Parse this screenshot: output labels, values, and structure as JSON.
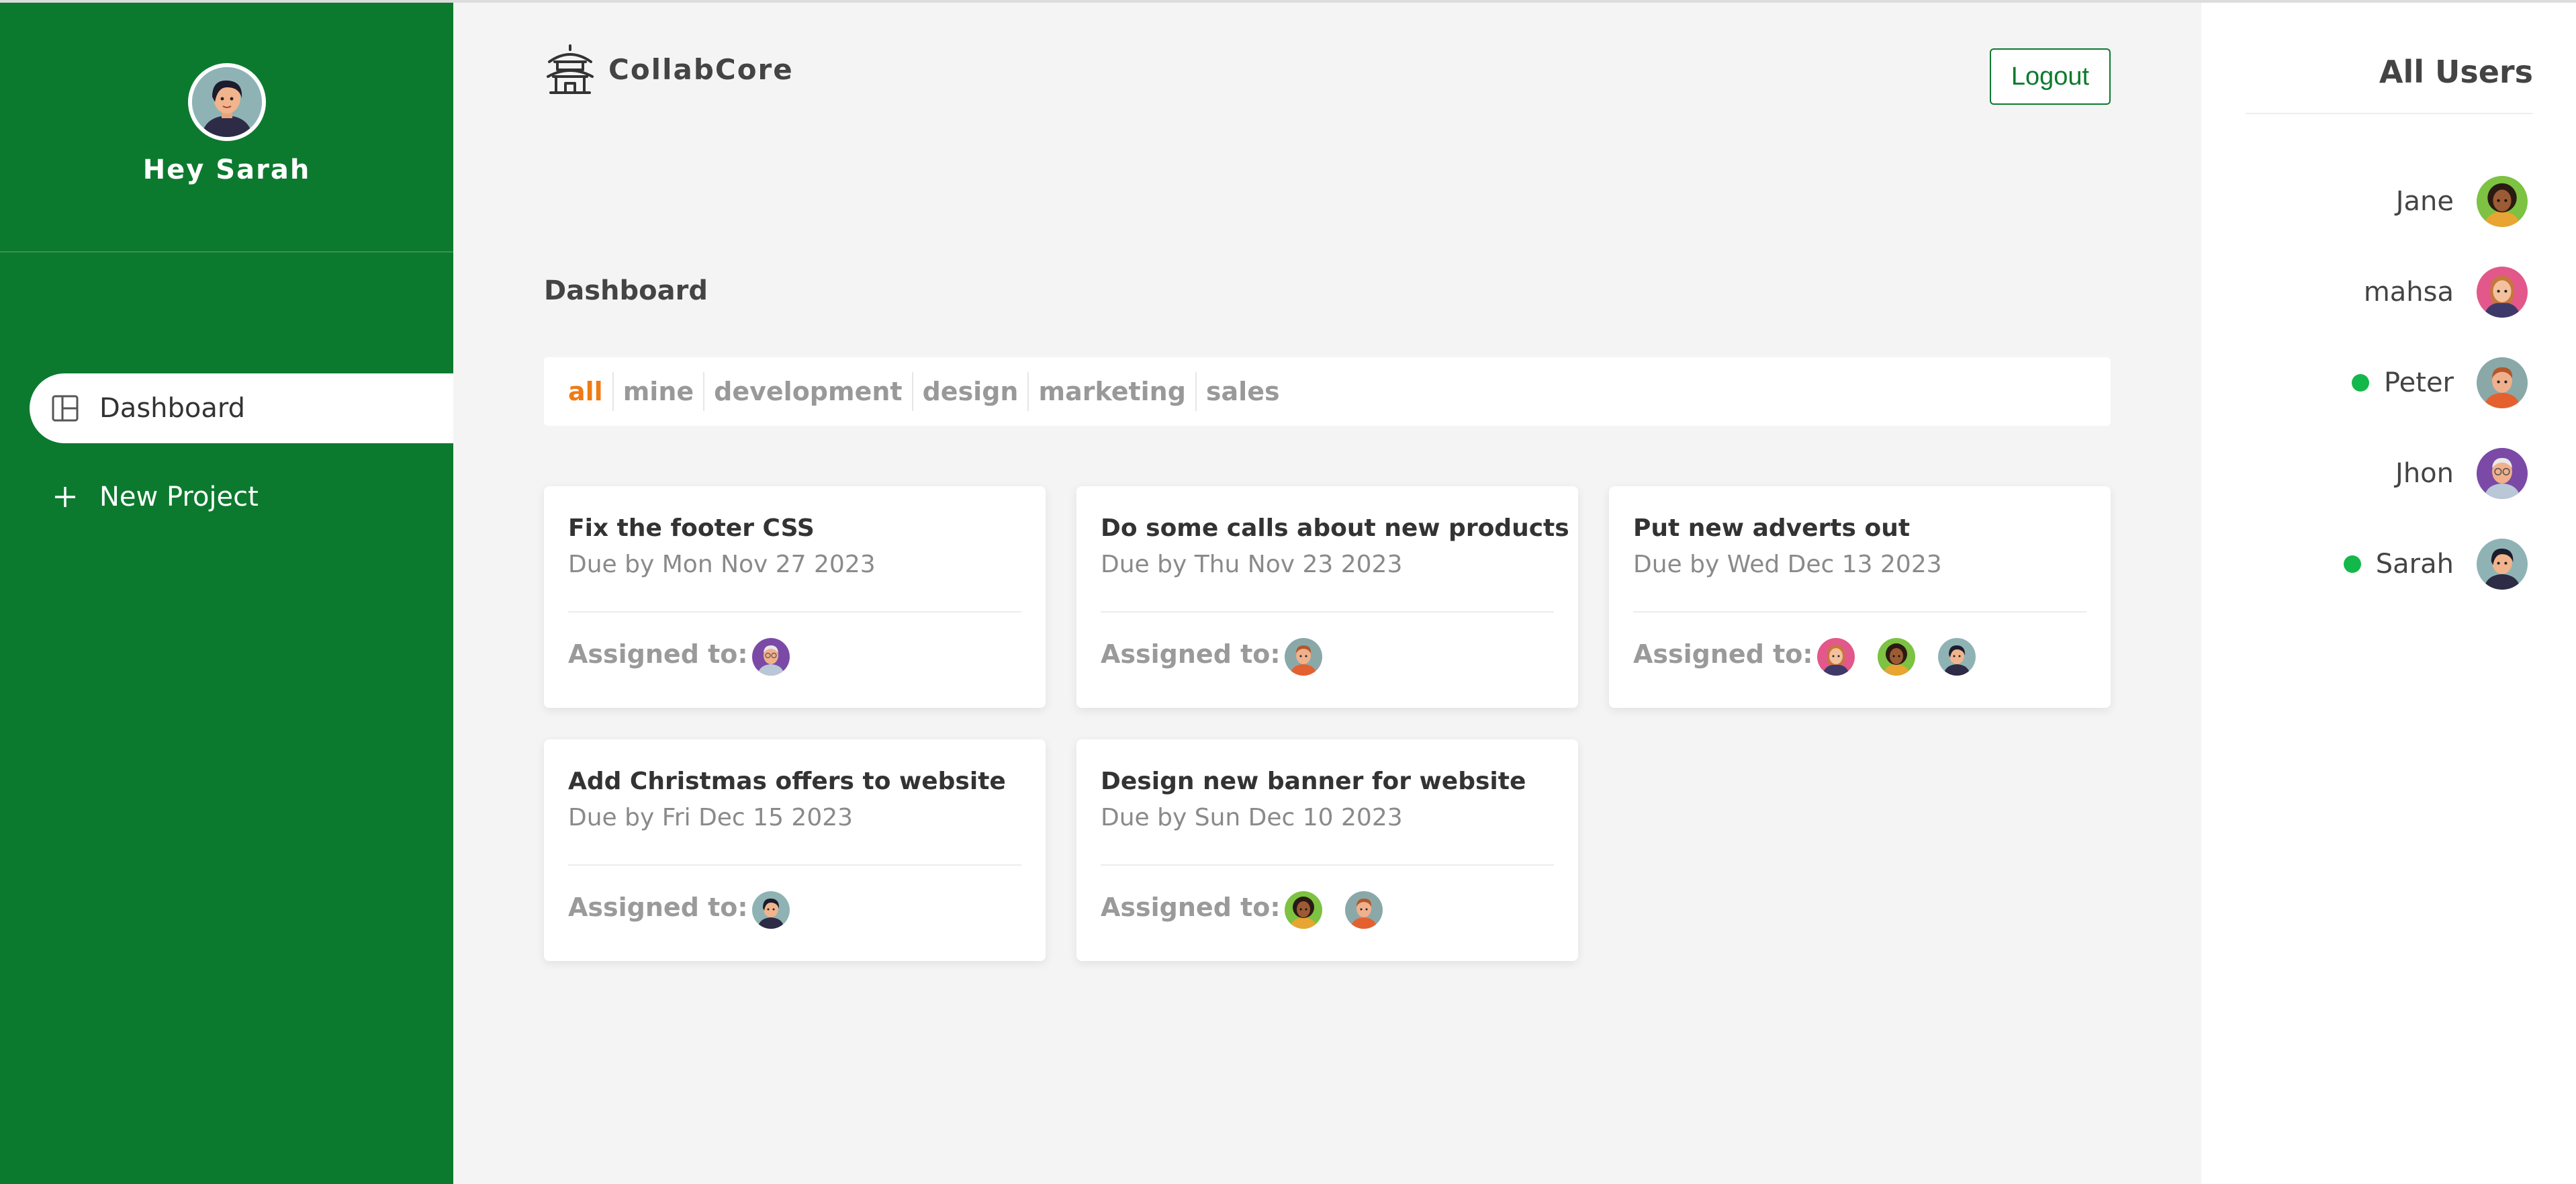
{
  "sidebar": {
    "greeting": "Hey Sarah",
    "nav": [
      {
        "label": "Dashboard",
        "icon": "layout-icon",
        "active": true
      },
      {
        "label": "New Project",
        "icon": "plus-icon",
        "active": false
      }
    ]
  },
  "header": {
    "brand": "CollabCore",
    "logout_label": "Logout"
  },
  "main": {
    "title": "Dashboard",
    "filters": [
      {
        "label": "all",
        "active": true
      },
      {
        "label": "mine",
        "active": false
      },
      {
        "label": "development",
        "active": false
      },
      {
        "label": "design",
        "active": false
      },
      {
        "label": "marketing",
        "active": false
      },
      {
        "label": "sales",
        "active": false
      }
    ],
    "assigned_label": "Assigned to:",
    "projects": [
      {
        "title": "Fix the footer CSS",
        "due": "Due by Mon Nov 27 2023",
        "assignees": [
          "Jhon"
        ]
      },
      {
        "title": "Do some calls about new products",
        "due": "Due by Thu Nov 23 2023",
        "assignees": [
          "Peter"
        ]
      },
      {
        "title": "Put new adverts out",
        "due": "Due by Wed Dec 13 2023",
        "assignees": [
          "mahsa",
          "Jane",
          "Sarah"
        ]
      },
      {
        "title": "Add Christmas offers to website",
        "due": "Due by Fri Dec 15 2023",
        "assignees": [
          "Sarah"
        ]
      },
      {
        "title": "Design new banner for website",
        "due": "Due by Sun Dec 10 2023",
        "assignees": [
          "Jane",
          "Peter"
        ]
      }
    ]
  },
  "users_panel": {
    "title": "All Users",
    "users": [
      {
        "name": "Jane",
        "online": false
      },
      {
        "name": "mahsa",
        "online": false
      },
      {
        "name": "Peter",
        "online": true
      },
      {
        "name": "Jhon",
        "online": false
      },
      {
        "name": "Sarah",
        "online": true
      }
    ]
  },
  "colors": {
    "sidebar": "#0c7a2e",
    "accent_filter": "#f07a14",
    "online_dot": "#12b84a"
  }
}
